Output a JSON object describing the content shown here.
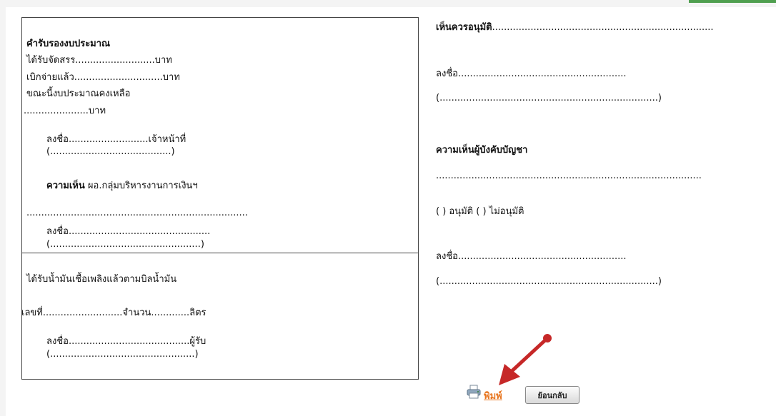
{
  "left_panel": {
    "budget": {
      "heading": "คำรับรองงบประมาณ",
      "line1": "ได้รับจัดสรร...........................บาท",
      "line2": "เบิกจ่ายแล้ว..............................บาท",
      "line3": "ขณะนี้งบประมาณคงเหลือ",
      "line4": "......................บาท",
      "sign_line": "ลงชื่อ...........................เจ้าหน้าที่",
      "sign_paren": "(.........................................)",
      "opinion_bold": "ความเห็น",
      "opinion_rest": " ผอ.กลุ่มบริหารงานการเงินฯ",
      "opinion_dots": "...........................................................................",
      "sign2_line": "ลงชื่อ................................................",
      "sign2_paren": "(...................................................)"
    },
    "fuel": {
      "heading": "ได้รับน้ำมันเชื้อเพลิงแล้วตามบิลน้ำมัน",
      "number_line": "เลขที่...........................จำนวน.............ลิตร",
      "sign_line": "ลงชื่อ.........................................ผู้รับ",
      "sign_paren": "(.................................................)"
    }
  },
  "right_panel": {
    "approve_bold": "เห็นควรอนุมัติ",
    "approve_dots": "...........................................................................",
    "sign1_line": "ลงชื่อ.........................................................",
    "sign1_paren": "(..........................................................................)",
    "commander_heading": "ความเห็นผู้บังคับบัญชา",
    "commander_dots": "..........................................................................................",
    "options": "( ) อนุมัติ    ( ) ไม่อนุมัติ",
    "sign2_line": "ลงชื่อ.........................................................",
    "sign2_paren": "(..........................................................................)"
  },
  "actions": {
    "print_label": "พิมพ์",
    "back_label": "ย้อนกลับ",
    "print_icon": "printer-icon",
    "annotation_icon": "red-arrow-icon",
    "arrow_color": "#c62828",
    "print_color": "#e87722"
  }
}
